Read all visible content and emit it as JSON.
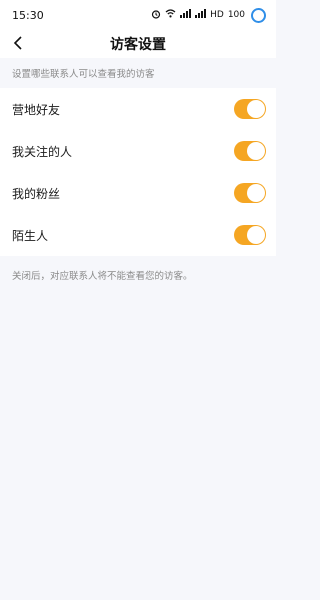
{
  "status_bar": {
    "time": "15:30",
    "network_label": "HD",
    "battery": "100"
  },
  "header": {
    "title": "访客设置"
  },
  "section": {
    "hint": "设置哪些联系人可以查看我的访客"
  },
  "settings": [
    {
      "label": "营地好友",
      "enabled": true
    },
    {
      "label": "我关注的人",
      "enabled": true
    },
    {
      "label": "我的粉丝",
      "enabled": true
    },
    {
      "label": "陌生人",
      "enabled": true
    }
  ],
  "footer": {
    "note": "关闭后，对应联系人将不能查看您的访客。"
  },
  "colors": {
    "toggle_on": "#f5a623",
    "battery_ring": "#2f8ee8"
  }
}
